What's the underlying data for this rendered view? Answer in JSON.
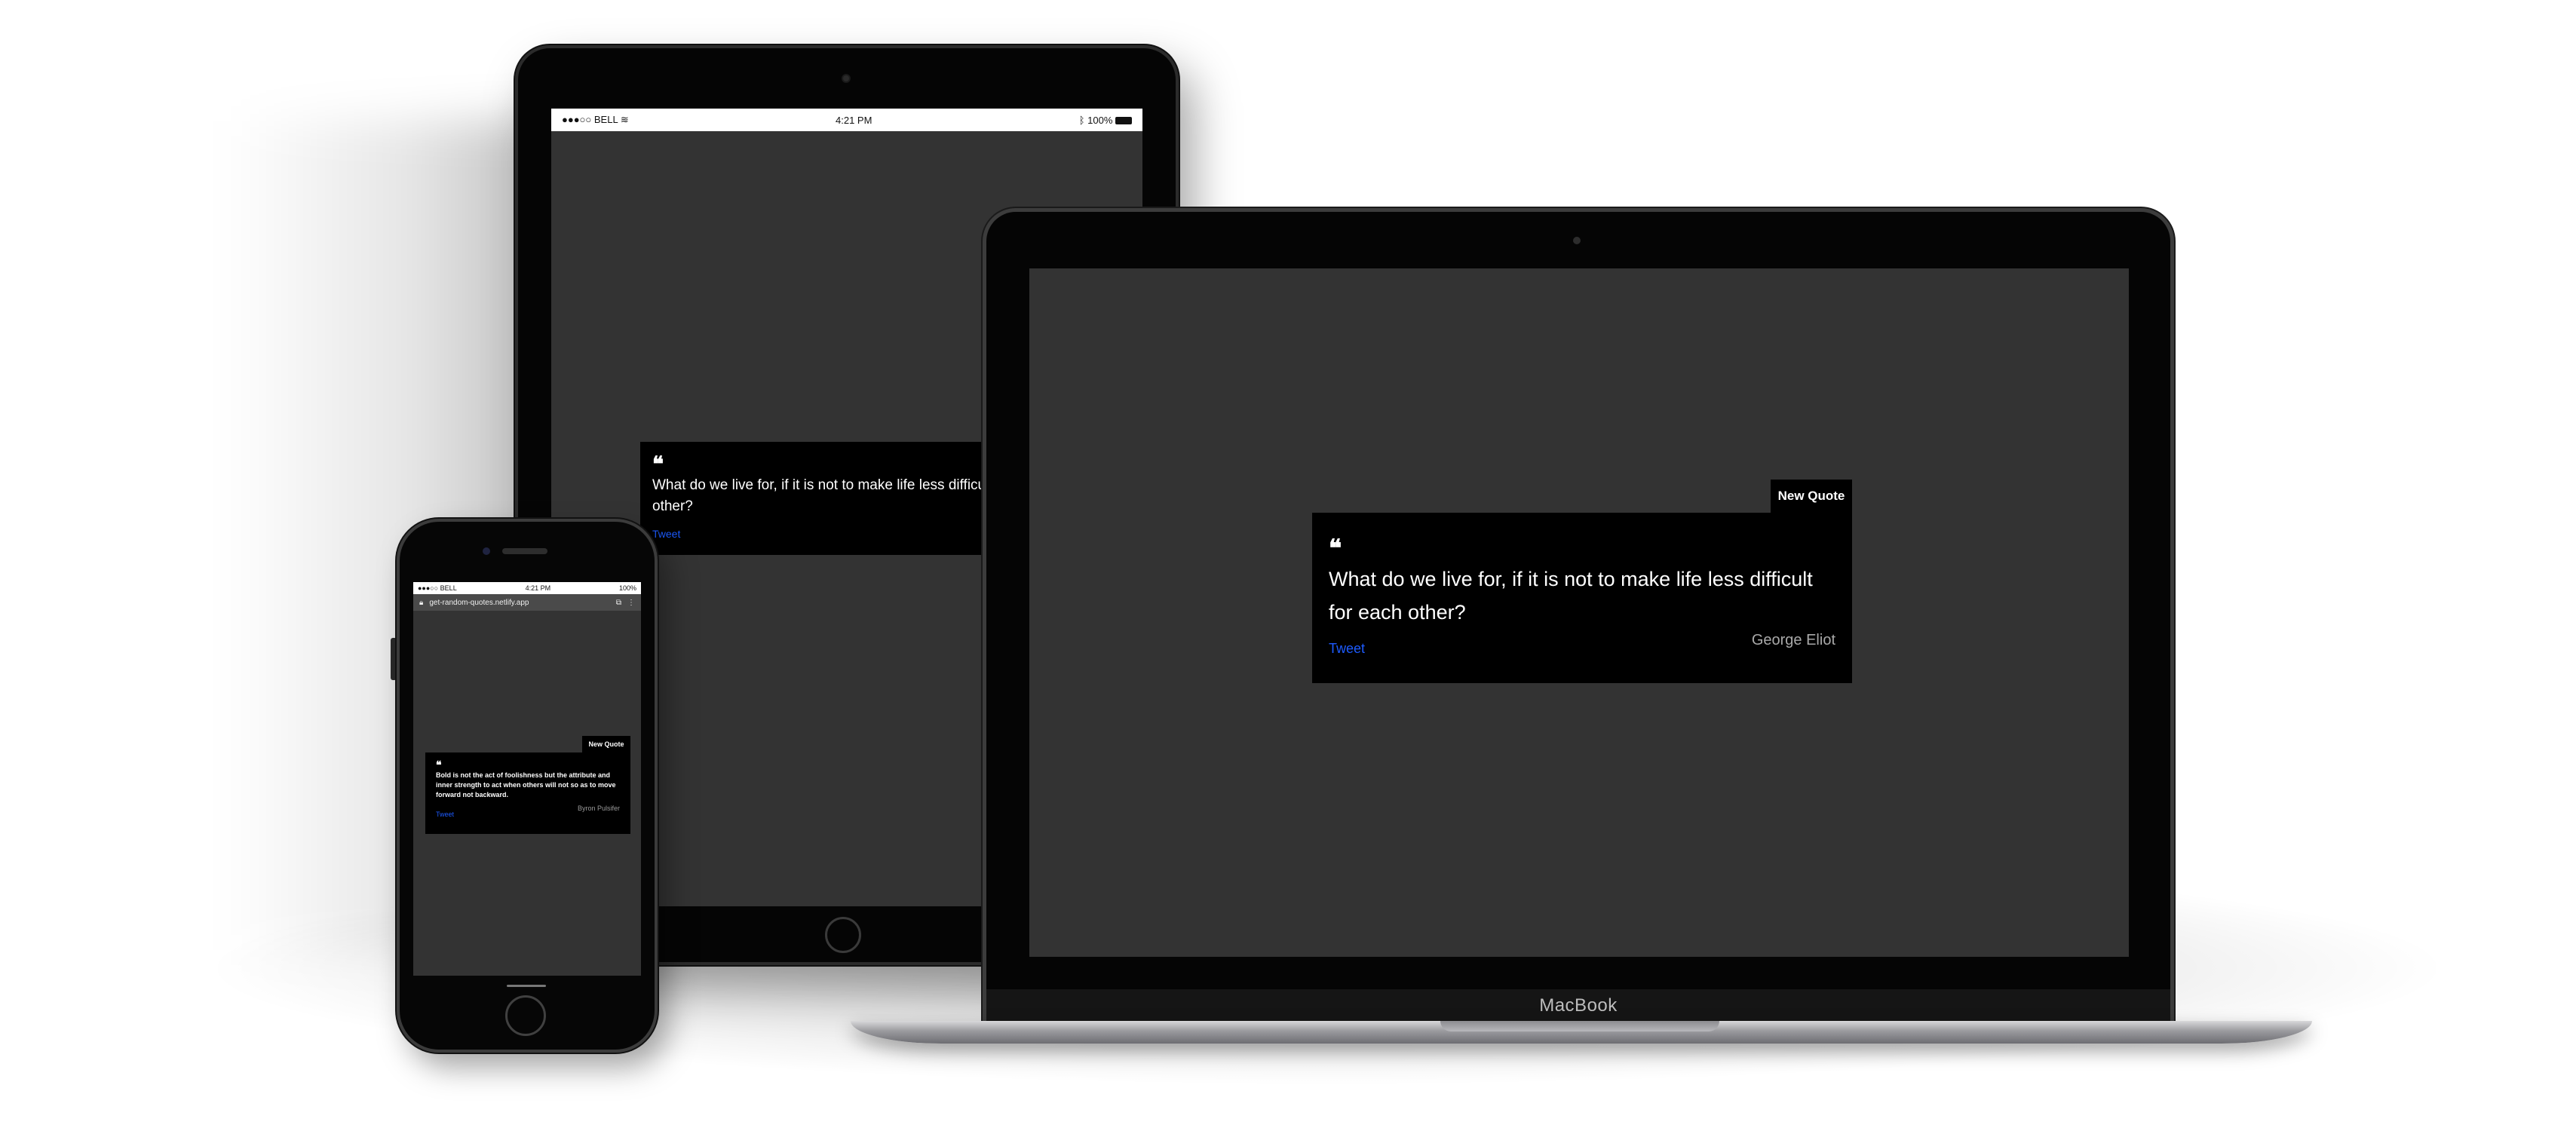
{
  "ipad": {
    "status": {
      "carrier": "●●●○○ BELL",
      "wifi_icon": "wifi-icon",
      "time": "4:21 PM",
      "bluetooth_icon": "bluetooth-icon",
      "battery": "100%"
    },
    "card": {
      "quote_icon": "❝",
      "text": "What do we live for, if it is not to make life less difficult for each",
      "text_line2": "other?",
      "tweet_label": "Tweet"
    }
  },
  "iphone": {
    "status": {
      "carrier": "●●●○○ BELL",
      "time": "4:21 PM",
      "battery": "100%"
    },
    "url": "get-random-quotes.netlify.app",
    "new_quote_label": "New Quote",
    "card": {
      "quote_icon": "❝",
      "text": "Bold is not the act of foolishness but the attribute and inner strength to act when others will not so as to move forward not backward.",
      "tweet_label": "Tweet",
      "author": "Byron Pulsifer"
    }
  },
  "macbook": {
    "brand": "MacBook",
    "new_quote_label": "New Quote",
    "card": {
      "quote_icon": "❝",
      "text": "What do we live for, if it is not to make life less difficult for each other?",
      "tweet_label": "Tweet",
      "author": "George Eliot"
    }
  },
  "colors": {
    "screen_bg": "#333333",
    "card_bg": "#000000",
    "link": "#1d5bff",
    "author": "#a9a9a9"
  }
}
